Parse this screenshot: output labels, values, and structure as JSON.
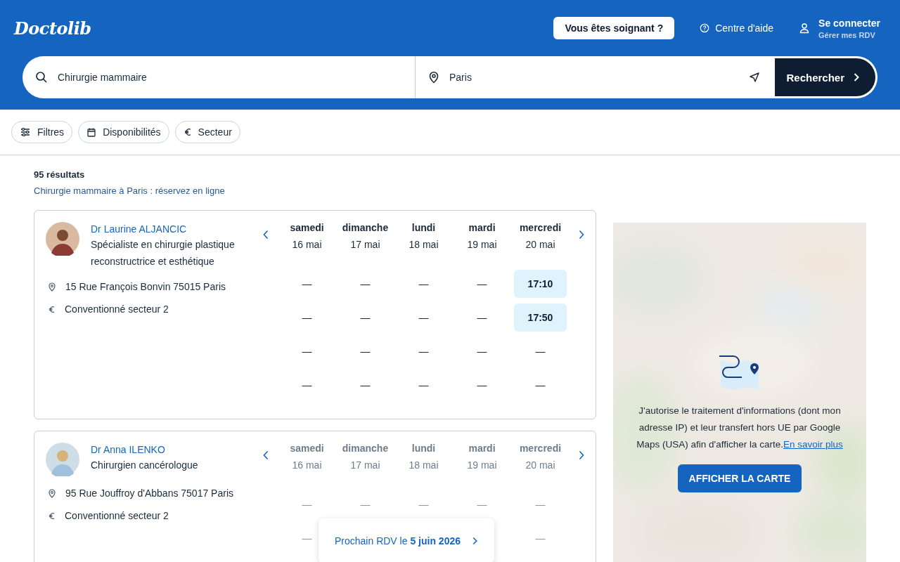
{
  "header": {
    "logo": "Doctolib",
    "pro_button": "Vous êtes soignant ?",
    "help_link": "Centre d'aide",
    "login": {
      "title": "Se connecter",
      "subtitle": "Gérer mes RDV"
    }
  },
  "search": {
    "query": "Chirurgie mammaire",
    "location": "Paris",
    "button": "Rechercher"
  },
  "filters": [
    {
      "kind": "sliders",
      "label": "Filtres"
    },
    {
      "kind": "calendar",
      "label": "Disponibilités"
    },
    {
      "kind": "euro",
      "label": "Secteur"
    }
  ],
  "results": {
    "count": "95 résultats",
    "subtitle": "Chirurgie mammaire à Paris : réservez en ligne"
  },
  "doctors": [
    {
      "name": "Dr Laurine ALJANCIC",
      "specialty": "Spécialiste en chirurgie plastique reconstructrice et esthétique",
      "address": "15 Rue François Bonvin 75015 Paris",
      "sector": "Conventionné secteur 2",
      "faded": false,
      "days": [
        {
          "day": "samedi",
          "date": "16 mai"
        },
        {
          "day": "dimanche",
          "date": "17 mai"
        },
        {
          "day": "lundi",
          "date": "18 mai"
        },
        {
          "day": "mardi",
          "date": "19 mai"
        },
        {
          "day": "mercredi",
          "date": "20 mai"
        }
      ],
      "slots": [
        [
          {
            "kind": "none",
            "text": "—"
          },
          {
            "kind": "none",
            "text": "—"
          },
          {
            "kind": "none",
            "text": "—"
          },
          {
            "kind": "none",
            "text": "—"
          },
          {
            "kind": "time",
            "text": "17:10"
          }
        ],
        [
          {
            "kind": "none",
            "text": "—"
          },
          {
            "kind": "none",
            "text": "—"
          },
          {
            "kind": "none",
            "text": "—"
          },
          {
            "kind": "none",
            "text": "—"
          },
          {
            "kind": "time",
            "text": "17:50"
          }
        ],
        [
          {
            "kind": "none",
            "text": "—"
          },
          {
            "kind": "none",
            "text": "—"
          },
          {
            "kind": "none",
            "text": "—"
          },
          {
            "kind": "none",
            "text": "—"
          },
          {
            "kind": "none",
            "text": "—"
          }
        ],
        [
          {
            "kind": "none",
            "text": "—"
          },
          {
            "kind": "none",
            "text": "—"
          },
          {
            "kind": "none",
            "text": "—"
          },
          {
            "kind": "none",
            "text": "—"
          },
          {
            "kind": "none",
            "text": "—"
          }
        ]
      ]
    },
    {
      "name": "Dr Anna ILENKO",
      "specialty": "Chirurgien cancérologue",
      "address": "95 Rue Jouffroy d'Abbans 75017 Paris",
      "sector": "Conventionné secteur 2",
      "faded": true,
      "days": [
        {
          "day": "samedi",
          "date": "16 mai"
        },
        {
          "day": "dimanche",
          "date": "17 mai"
        },
        {
          "day": "lundi",
          "date": "18 mai"
        },
        {
          "day": "mardi",
          "date": "19 mai"
        },
        {
          "day": "mercredi",
          "date": "20 mai"
        }
      ],
      "slots": [
        [
          {
            "kind": "none",
            "text": "—"
          },
          {
            "kind": "none",
            "text": "—"
          },
          {
            "kind": "none",
            "text": "—"
          },
          {
            "kind": "none",
            "text": "—"
          },
          {
            "kind": "none",
            "text": "—"
          }
        ],
        [
          {
            "kind": "none",
            "text": "—"
          },
          {
            "kind": "hidden"
          },
          {
            "kind": "hidden"
          },
          {
            "kind": "hidden"
          },
          {
            "kind": "none",
            "text": "—"
          }
        ]
      ],
      "next_appointment": "Prochain RDV le **5 juin 2026**"
    }
  ],
  "map": {
    "consent": "J'autorise le traitement d'informations (dont mon adresse IP) et leur transfert hors UE par Google Maps (USA) afin d'afficher la carte.",
    "link": "En savoir plus",
    "button": "AFFICHER LA CARTE"
  }
}
